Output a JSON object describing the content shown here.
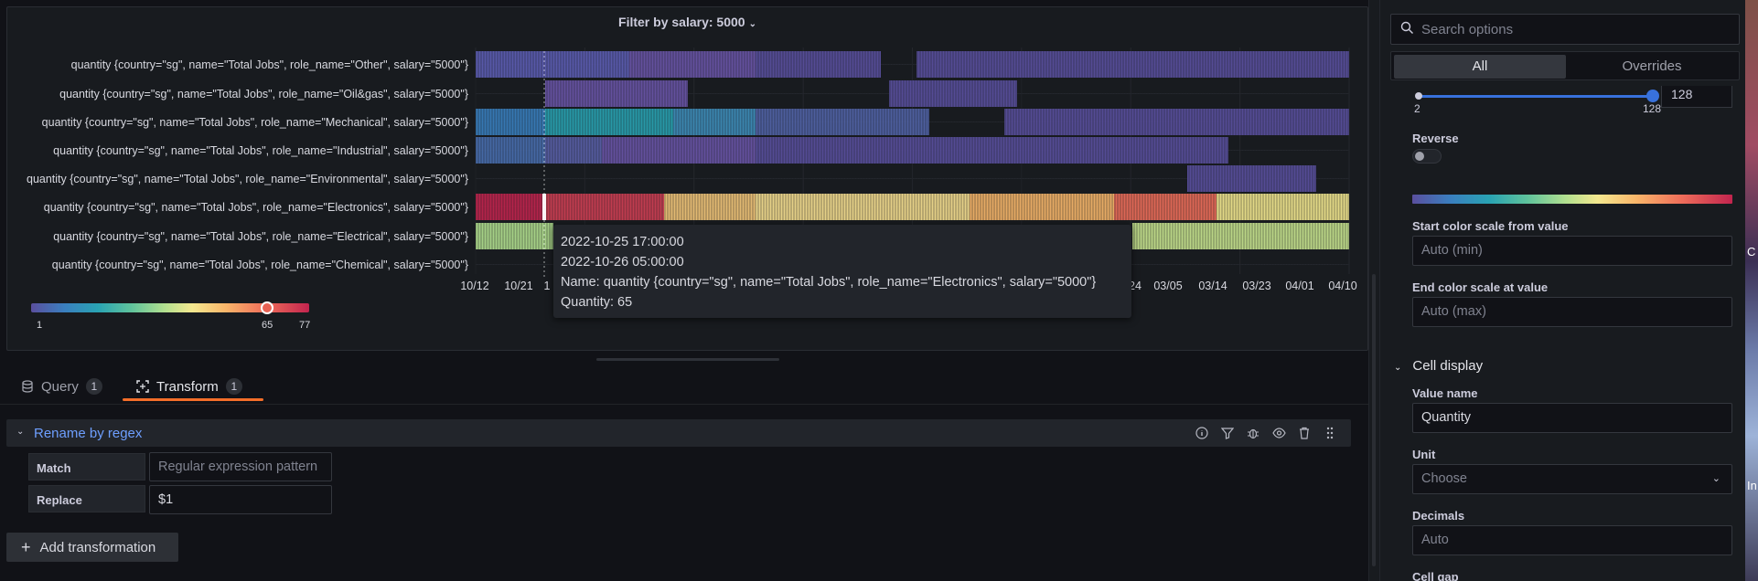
{
  "panel": {
    "title": "Filter by salary: 5000",
    "rows": [
      {
        "label": "quantity {country=\"sg\", name=\"Total Jobs\", role_name=\"Other\", salary=\"5000\"}"
      },
      {
        "label": "quantity {country=\"sg\", name=\"Total Jobs\", role_name=\"Oil&gas\", salary=\"5000\"}"
      },
      {
        "label": "quantity {country=\"sg\", name=\"Total Jobs\", role_name=\"Mechanical\", salary=\"5000\"}"
      },
      {
        "label": "quantity {country=\"sg\", name=\"Total Jobs\", role_name=\"Industrial\", salary=\"5000\"}"
      },
      {
        "label": "quantity {country=\"sg\", name=\"Total Jobs\", role_name=\"Environmental\", salary=\"5000\"}"
      },
      {
        "label": "quantity {country=\"sg\", name=\"Total Jobs\", role_name=\"Electronics\", salary=\"5000\"}"
      },
      {
        "label": "quantity {country=\"sg\", name=\"Total Jobs\", role_name=\"Electrical\", salary=\"5000\"}"
      },
      {
        "label": "quantity {country=\"sg\", name=\"Total Jobs\", role_name=\"Chemical\", salary=\"5000\"}"
      }
    ],
    "x_ticks": [
      "10/12",
      "10/21",
      "1",
      "24",
      "03/05",
      "03/14",
      "03/23",
      "04/01",
      "04/10"
    ],
    "legend": {
      "min": "1",
      "mid": "65",
      "max": "77"
    },
    "colors": {
      "panel_bg": "#181b1f",
      "accent": "#f46e29",
      "link": "#6e9fff"
    }
  },
  "tooltip": {
    "line1": "2022-10-25 17:00:00",
    "line2": "2022-10-26 05:00:00",
    "line3": "Name: quantity {country=\"sg\", name=\"Total Jobs\", role_name=\"Electronics\", salary=\"5000\"}",
    "line4": "Quantity: 65"
  },
  "tabs": [
    {
      "label": "Query",
      "count": "1",
      "icon": "database-icon"
    },
    {
      "label": "Transform",
      "count": "1",
      "icon": "transform-icon",
      "active": true
    }
  ],
  "transform": {
    "title": "Rename by regex",
    "match_label": "Match",
    "match_placeholder": "Regular expression pattern",
    "replace_label": "Replace",
    "replace_value": "$1",
    "icons": [
      "info-icon",
      "filter-icon",
      "debug-icon",
      "eye-icon",
      "trash-icon",
      "drag-handle-icon"
    ]
  },
  "add_transformation": "Add transformation",
  "sidebar": {
    "search_placeholder": "Search options",
    "seg_all": "All",
    "seg_overrides": "Overrides",
    "slider_min": "2",
    "slider_max": "128",
    "slider_box": "128",
    "reverse_label": "Reverse",
    "start_label": "Start color scale from value",
    "start_placeholder": "Auto (min)",
    "end_label": "End color scale at value",
    "end_placeholder": "Auto (max)",
    "cell_display": "Cell display",
    "value_name_label": "Value name",
    "value_name": "Quantity",
    "unit_label": "Unit",
    "unit_value": "Choose",
    "decimals_label": "Decimals",
    "decimals_placeholder": "Auto",
    "cell_gap_label": "Cell gap"
  },
  "photo_chars": [
    "C",
    "In"
  ]
}
